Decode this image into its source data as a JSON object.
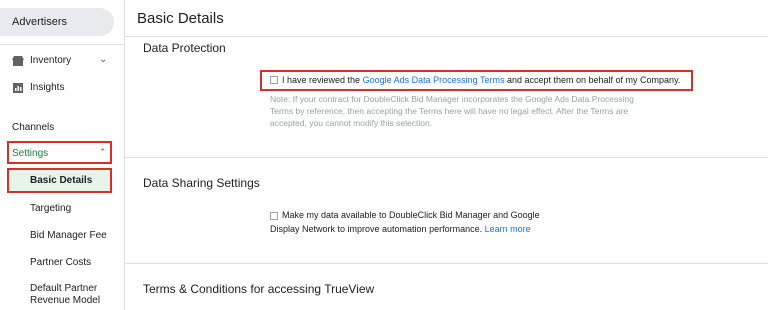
{
  "sidebar": {
    "advertisers": "Advertisers",
    "inventory": "Inventory",
    "insights": "Insights",
    "channels": "Channels",
    "settings": "Settings",
    "basic_details": "Basic Details",
    "targeting": "Targeting",
    "bid_manager_fee": "Bid Manager Fee",
    "partner_costs": "Partner Costs",
    "default_partner_revenue_model_line1": "Default Partner",
    "default_partner_revenue_model_line2": "Revenue Model"
  },
  "main": {
    "title": "Basic Details",
    "data_protection": {
      "title": "Data Protection",
      "checkbox_text_before": "I have reviewed the ",
      "checkbox_link": "Google Ads Data Processing Terms",
      "checkbox_text_after": " and accept them on behalf of my Company.",
      "note_line1": "Note: If your contract for DoubleClick Bid Manager incorporates the Google Ads Data Processing",
      "note_line2": "Terms by reference, then accepting the Terms here will have no legal effect. After the Terms are",
      "note_line3": "accepted, you cannot modify this selection."
    },
    "data_sharing": {
      "title": "Data Sharing Settings",
      "line1": "Make my data available to DoubleClick Bid Manager and Google",
      "line2": "Display Network to improve automation performance. ",
      "learn_more": "Learn more"
    },
    "terms_title": "Terms & Conditions for accessing TrueView"
  },
  "colors": {
    "accent_green": "#188038",
    "highlight_red": "#d93025",
    "link_blue": "#1a73e8",
    "selected_bg": "#e6f4ea"
  }
}
